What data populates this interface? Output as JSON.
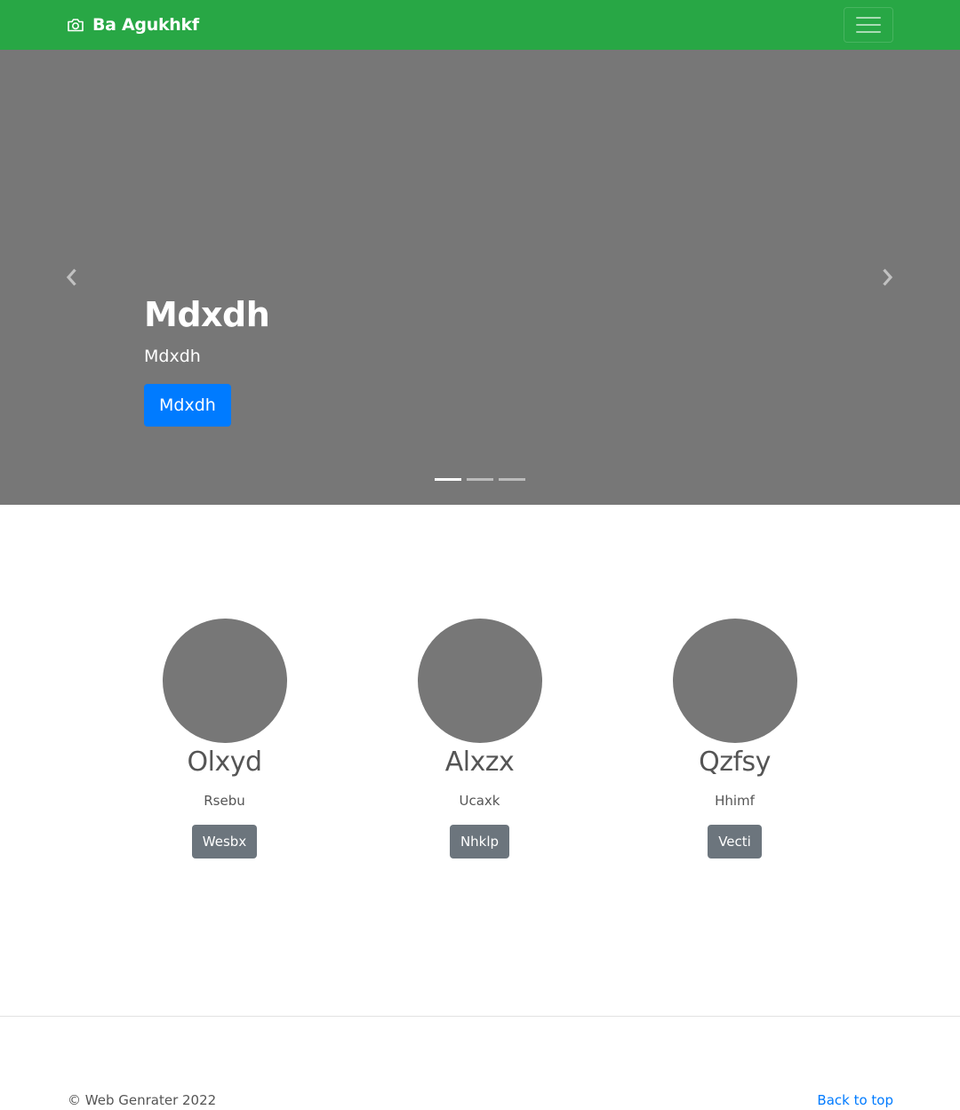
{
  "navbar": {
    "brand": "Ba Agukhkf",
    "brand_icon": "camera-icon",
    "menu_icon": "hamburger-menu-icon",
    "background_color": "#28a745"
  },
  "carousel": {
    "title": "Mdxdh",
    "subtitle": "Mdxdh",
    "button_label": "Mdxdh",
    "prev_icon": "chevron-left-icon",
    "next_icon": "chevron-right-icon",
    "slide_count": 3,
    "active_slide": 1,
    "background_color": "#777777",
    "button_color": "#007bff"
  },
  "columns": [
    {
      "title": "Olxyd",
      "text": "Rsebu",
      "button_label": "Wesbx"
    },
    {
      "title": "Alxzx",
      "text": "Ucaxk",
      "button_label": "Nhklp"
    },
    {
      "title": "Qzfsy",
      "text": "Hhimf",
      "button_label": "Vecti"
    }
  ],
  "footer": {
    "copyright": "© Web Genrater 2022",
    "back_to_top": "Back to top",
    "link_color": "#007bff"
  }
}
